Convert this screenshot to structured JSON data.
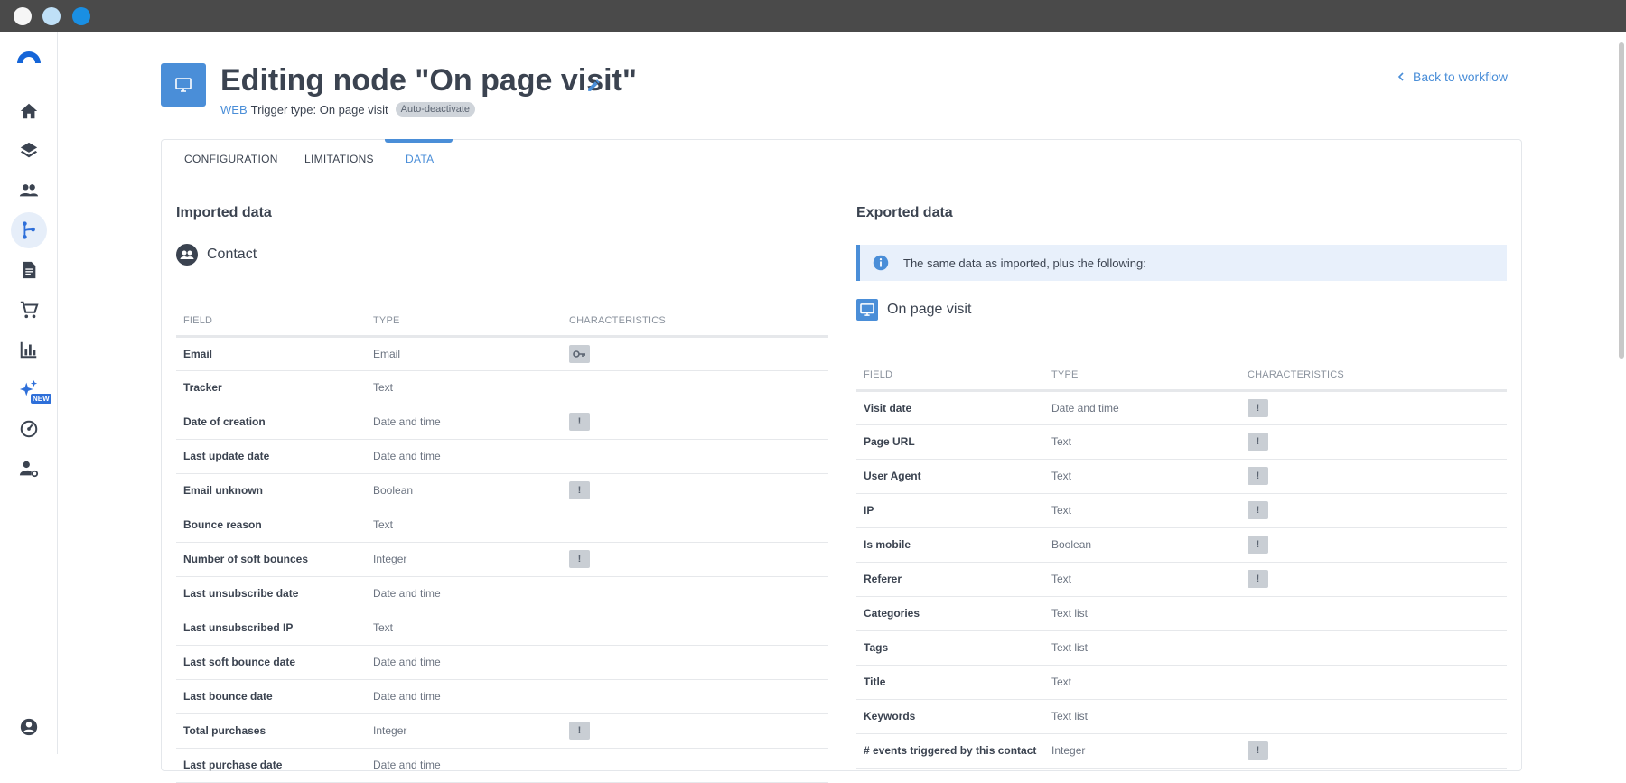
{
  "app": {
    "title": "Editing node \"On page visit\"",
    "channel": "WEB",
    "trigger_type": "Trigger type: On page visit",
    "badge": "Auto-deactivate",
    "back_link": "Back to workflow"
  },
  "sidebar": {
    "items": [
      {
        "name": "home-icon"
      },
      {
        "name": "layers-icon"
      },
      {
        "name": "contacts-icon"
      },
      {
        "name": "workflow-icon",
        "active": true
      },
      {
        "name": "document-icon"
      },
      {
        "name": "cart-icon"
      },
      {
        "name": "chart-icon"
      },
      {
        "name": "sparkles-icon",
        "badge": "NEW"
      },
      {
        "name": "speedometer-icon"
      },
      {
        "name": "user-settings-icon"
      }
    ],
    "bottom": {
      "name": "account-icon"
    }
  },
  "tabs": [
    {
      "label": "CONFIGURATION"
    },
    {
      "label": "LIMITATIONS"
    },
    {
      "label": "DATA",
      "active": true
    }
  ],
  "imported": {
    "title": "Imported data",
    "entity": "Contact",
    "headers": [
      "FIELD",
      "TYPE",
      "CHARACTERISTICS"
    ],
    "rows": [
      {
        "field": "Email",
        "type": "Email",
        "char": "key"
      },
      {
        "field": "Tracker",
        "type": "Text",
        "char": ""
      },
      {
        "field": "Date of creation",
        "type": "Date and time",
        "char": "!"
      },
      {
        "field": "Last update date",
        "type": "Date and time",
        "char": ""
      },
      {
        "field": "Email unknown",
        "type": "Boolean",
        "char": "!"
      },
      {
        "field": "Bounce reason",
        "type": "Text",
        "char": ""
      },
      {
        "field": "Number of soft bounces",
        "type": "Integer",
        "char": "!"
      },
      {
        "field": "Last unsubscribe date",
        "type": "Date and time",
        "char": ""
      },
      {
        "field": "Last unsubscribed IP",
        "type": "Text",
        "char": ""
      },
      {
        "field": "Last soft bounce date",
        "type": "Date and time",
        "char": ""
      },
      {
        "field": "Last bounce date",
        "type": "Date and time",
        "char": ""
      },
      {
        "field": "Total purchases",
        "type": "Integer",
        "char": "!"
      },
      {
        "field": "Last purchase date",
        "type": "Date and time",
        "char": ""
      }
    ]
  },
  "exported": {
    "title": "Exported data",
    "info": "The same data as imported, plus the following:",
    "entity": "On page visit",
    "headers": [
      "FIELD",
      "TYPE",
      "CHARACTERISTICS"
    ],
    "rows": [
      {
        "field": "Visit date",
        "type": "Date and time",
        "char": "!"
      },
      {
        "field": "Page URL",
        "type": "Text",
        "char": "!"
      },
      {
        "field": "User Agent",
        "type": "Text",
        "char": "!"
      },
      {
        "field": "IP",
        "type": "Text",
        "char": "!"
      },
      {
        "field": "Is mobile",
        "type": "Boolean",
        "char": "!"
      },
      {
        "field": "Referer",
        "type": "Text",
        "char": "!"
      },
      {
        "field": "Categories",
        "type": "Text list",
        "char": ""
      },
      {
        "field": "Tags",
        "type": "Text list",
        "char": ""
      },
      {
        "field": "Title",
        "type": "Text",
        "char": ""
      },
      {
        "field": "Keywords",
        "type": "Text list",
        "char": ""
      },
      {
        "field": "# events triggered by this contact",
        "type": "Integer",
        "char": "!"
      }
    ]
  },
  "colors": {
    "accent": "#4a8ed8",
    "chrome": "#4a4a4a"
  }
}
